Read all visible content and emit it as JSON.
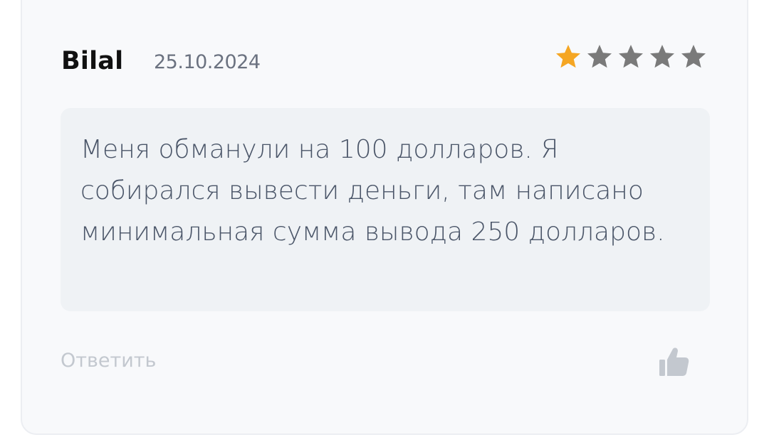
{
  "review": {
    "author": "Bilal",
    "date": "25.10.2024",
    "rating": 1,
    "max_rating": 5,
    "text": "Меня обманули на 100 долларов. Я собирался вывести деньги, там написано минимальная сумма вывода 250 долларов.",
    "reply_label": "Ответить",
    "like_icon": "thumbs-up-icon"
  },
  "colors": {
    "star_filled": "#f5a623",
    "star_empty": "#7a7a7a",
    "like_icon": "#c3c8cf"
  }
}
